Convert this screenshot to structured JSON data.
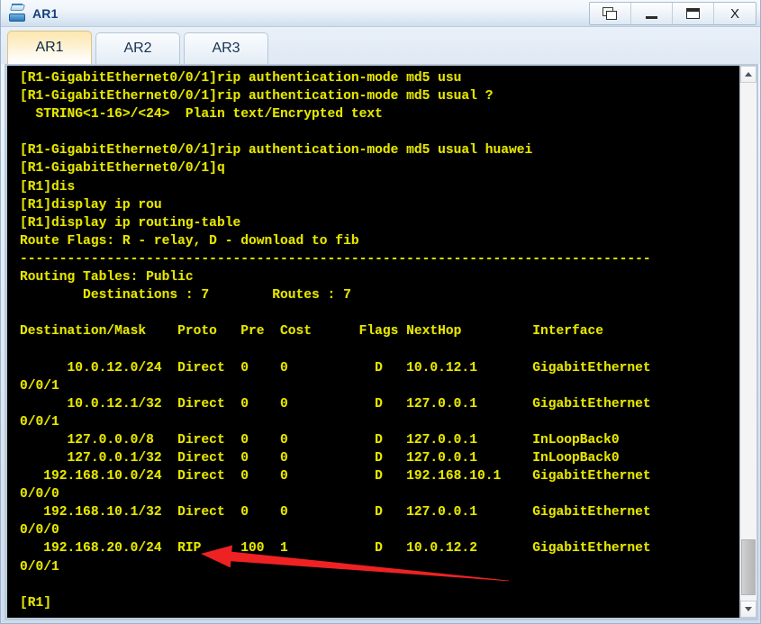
{
  "window": {
    "title": "AR1",
    "app_icon": "router-icon",
    "controls": [
      {
        "name": "cascade-button",
        "label": "",
        "icon": "cascade-icon"
      },
      {
        "name": "minimize-button",
        "label": "",
        "icon": "minimize-icon"
      },
      {
        "name": "maximize-button",
        "label": "",
        "icon": "maximize-icon"
      },
      {
        "name": "close-button",
        "label": "X",
        "icon": "close-icon"
      }
    ]
  },
  "tabs": [
    {
      "label": "AR1",
      "active": true
    },
    {
      "label": "AR2",
      "active": false
    },
    {
      "label": "AR3",
      "active": false
    }
  ],
  "terminal": {
    "foreground_color": "#e6e600",
    "background_color": "#000000",
    "lines": [
      "[R1-GigabitEthernet0/0/1]rip authentication-mode md5 usu",
      "[R1-GigabitEthernet0/0/1]rip authentication-mode md5 usual ?",
      "  STRING<1-16>/<24>  Plain text/Encrypted text",
      "",
      "[R1-GigabitEthernet0/0/1]rip authentication-mode md5 usual huawei",
      "[R1-GigabitEthernet0/0/1]q",
      "[R1]dis",
      "[R1]display ip rou",
      "[R1]display ip routing-table",
      "Route Flags: R - relay, D - download to fib",
      "--------------------------------------------------------------------------------",
      "Routing Tables: Public",
      "        Destinations : 7        Routes : 7",
      "",
      "Destination/Mask    Proto   Pre  Cost      Flags NextHop         Interface",
      "",
      "      10.0.12.0/24  Direct  0    0           D   10.0.12.1       GigabitEthernet",
      "0/0/1",
      "      10.0.12.1/32  Direct  0    0           D   127.0.0.1       GigabitEthernet",
      "0/0/1",
      "      127.0.0.0/8   Direct  0    0           D   127.0.0.1       InLoopBack0",
      "      127.0.0.1/32  Direct  0    0           D   127.0.0.1       InLoopBack0",
      "   192.168.10.0/24  Direct  0    0           D   192.168.10.1    GigabitEthernet",
      "0/0/0",
      "   192.168.10.1/32  Direct  0    0           D   127.0.0.1       GigabitEthernet",
      "0/0/0",
      "   192.168.20.0/24  RIP     100  1           D   10.0.12.2       GigabitEthernet",
      "0/0/1",
      "",
      "[R1]"
    ],
    "routing_table": {
      "headers": [
        "Destination/Mask",
        "Proto",
        "Pre",
        "Cost",
        "Flags",
        "NextHop",
        "Interface"
      ],
      "rows": [
        [
          "10.0.12.0/24",
          "Direct",
          "0",
          "0",
          "D",
          "10.0.12.1",
          "GigabitEthernet0/0/1"
        ],
        [
          "10.0.12.1/32",
          "Direct",
          "0",
          "0",
          "D",
          "127.0.0.1",
          "GigabitEthernet0/0/1"
        ],
        [
          "127.0.0.0/8",
          "Direct",
          "0",
          "0",
          "D",
          "127.0.0.1",
          "InLoopBack0"
        ],
        [
          "127.0.0.1/32",
          "Direct",
          "0",
          "0",
          "D",
          "127.0.0.1",
          "InLoopBack0"
        ],
        [
          "192.168.10.0/24",
          "Direct",
          "0",
          "0",
          "D",
          "192.168.10.1",
          "GigabitEthernet0/0/0"
        ],
        [
          "192.168.10.1/32",
          "Direct",
          "0",
          "0",
          "D",
          "127.0.0.1",
          "GigabitEthernet0/0/0"
        ],
        [
          "192.168.20.0/24",
          "RIP",
          "100",
          "1",
          "D",
          "10.0.12.2",
          "GigabitEthernet0/0/1"
        ]
      ],
      "destinations": "7",
      "routes": "7",
      "table_name": "Public",
      "route_flags": "R - relay, D - download to fib"
    },
    "prompt": "[R1]"
  },
  "annotation": {
    "type": "arrow",
    "color": "#ee2222",
    "points_to": "RIP"
  },
  "scrollbar": {
    "up_arrow": "chevron-up-icon",
    "down_arrow": "chevron-down-icon"
  }
}
